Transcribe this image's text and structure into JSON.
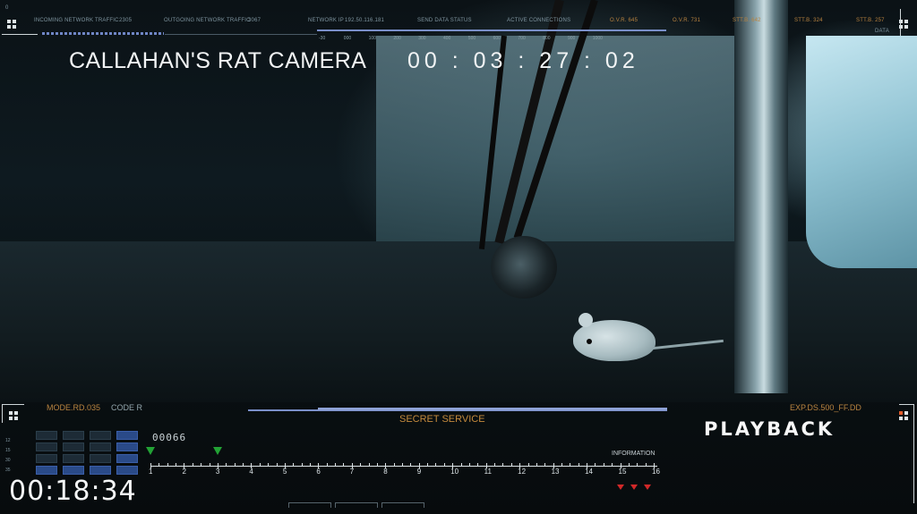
{
  "camera": {
    "title": "CALLAHAN'S RAT CAMERA",
    "timecode": "00 : 03 : 27 : 02",
    "status": "PLAYBACK",
    "clock": "00:18:34",
    "agency": "SECRET SERVICE"
  },
  "top_bar": {
    "incoming_label": "INCOMING NETWORK TRAFFIC",
    "incoming_value": "2305",
    "outgoing_label": "OUTGOING NETWORK TRAFFIC",
    "outgoing_value": "3067",
    "network_ip_label": "NETWORK IP",
    "network_ip_value": "192.50.116.181",
    "send_status_label": "SEND DATA STATUS",
    "connections_label": "ACTIVE CONNECTIONS",
    "ovr1": "O.V.R. 645",
    "ovr2": "O.V.R. 731",
    "sttb1": "STT.B. 642",
    "sttb2": "STT.B. 324",
    "sttb3": "STT.B. 257",
    "data_label": "DATA",
    "corner_zero": "0",
    "scale": [
      "-30",
      "000",
      "100",
      "200",
      "300",
      "400",
      "500",
      "600",
      "700",
      "800",
      "900",
      "1000"
    ]
  },
  "bottom_bar": {
    "mode": "MODE.RD.035",
    "code": "CODE R",
    "exp": "EXP.DS.500_FF.DD",
    "counter": "00066",
    "info_label": "INFORMATION",
    "grid_labels": [
      "12",
      "15",
      "30",
      "35"
    ],
    "grid_lit": [
      [
        false,
        false,
        false,
        true
      ],
      [
        false,
        false,
        false,
        true
      ],
      [
        false,
        false,
        false,
        true
      ],
      [
        true,
        true,
        true,
        true
      ]
    ],
    "timeline": [
      "1",
      "2",
      "3",
      "4",
      "5",
      "6",
      "7",
      "8",
      "9",
      "10",
      "11",
      "12",
      "13",
      "14",
      "15",
      "16"
    ],
    "green_markers_at": [
      1,
      3
    ],
    "red_markers_at": [
      15,
      15.4,
      15.8
    ]
  },
  "colors": {
    "accent_blue": "#7a8fc9",
    "hud_orange": "#b9833f",
    "marker_green": "#22a235",
    "marker_red": "#d12828"
  }
}
